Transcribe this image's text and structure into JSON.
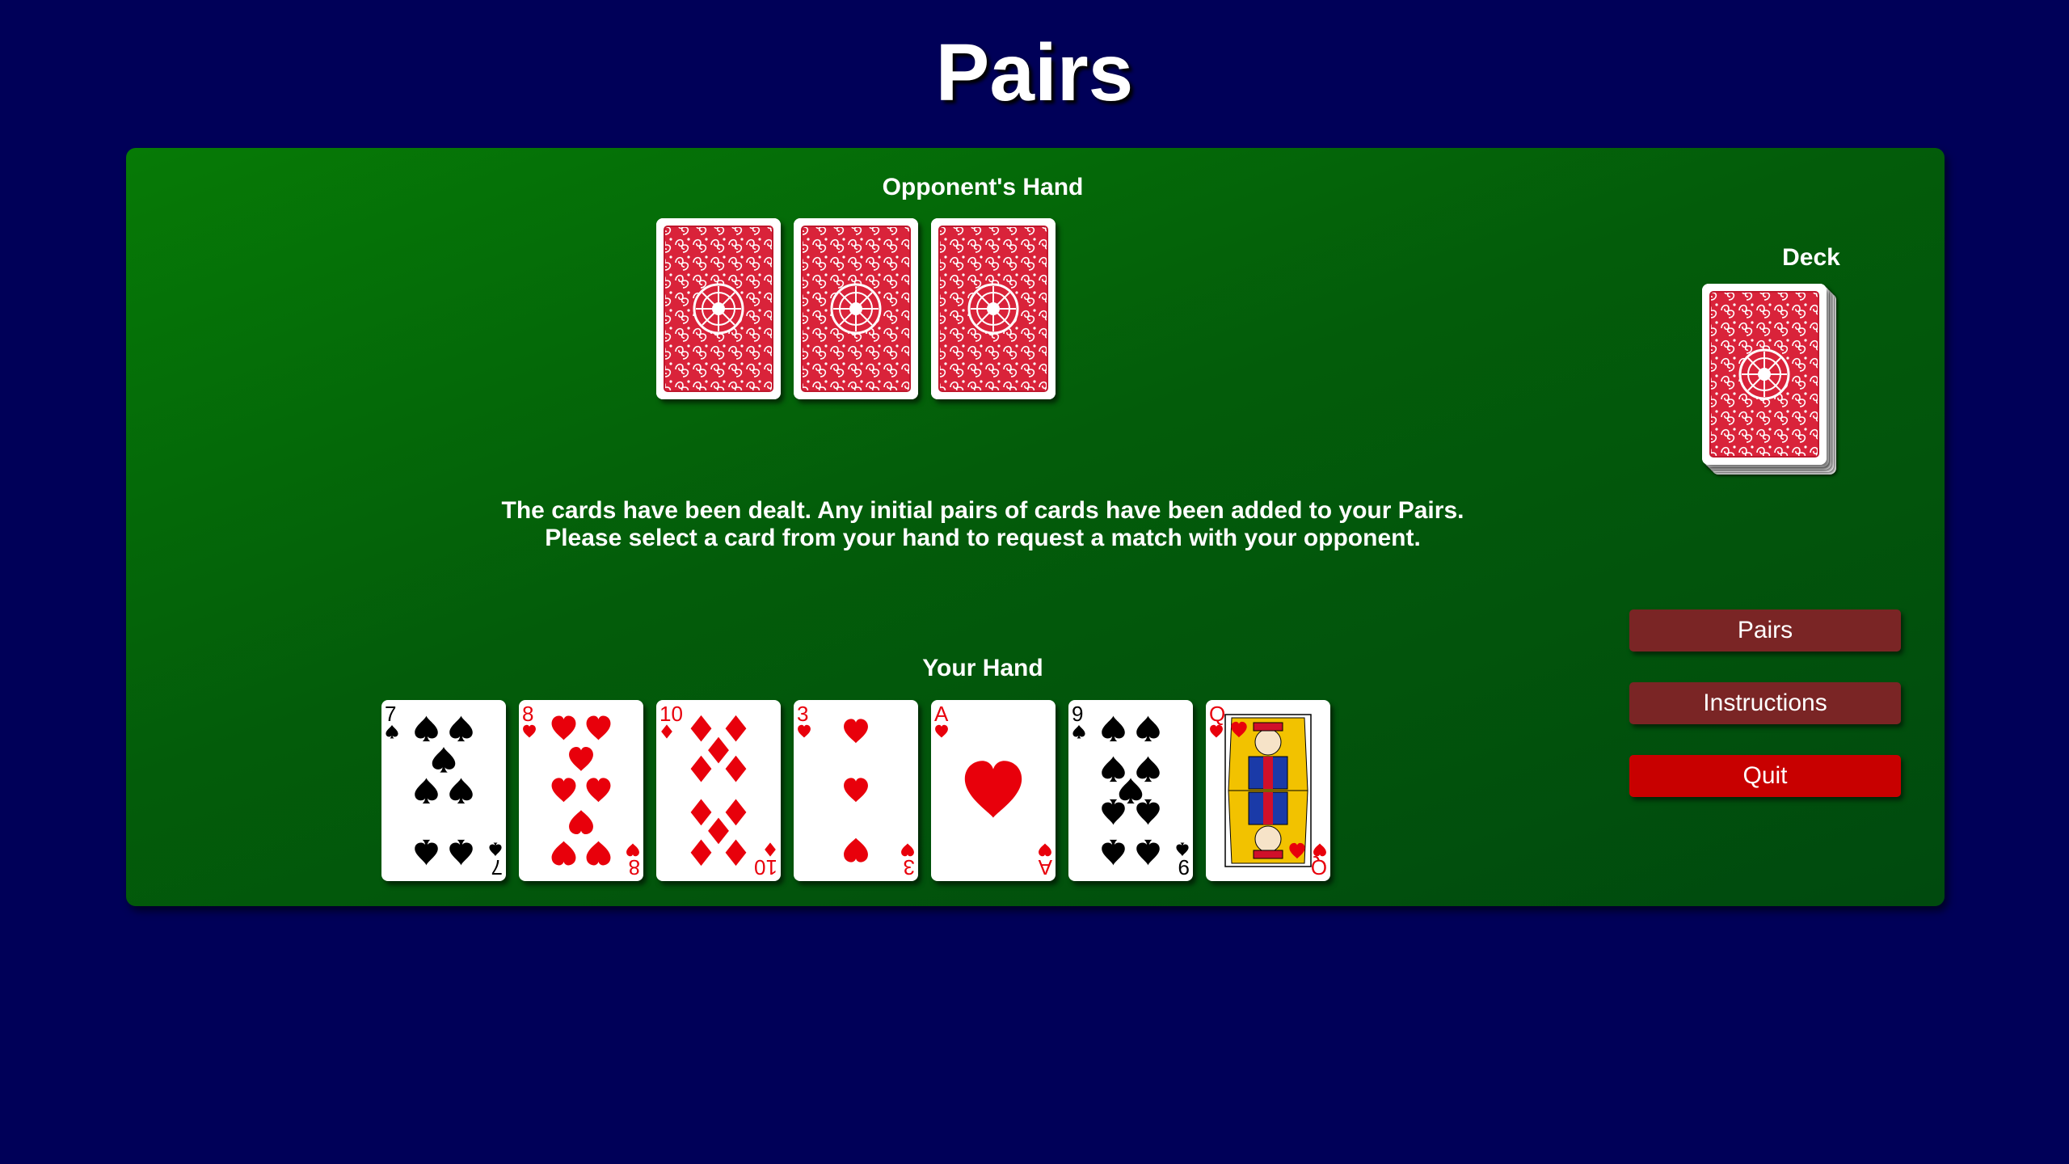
{
  "title": "Pairs",
  "opponent": {
    "label": "Opponent's Hand",
    "card_count": 3
  },
  "deck": {
    "label": "Deck"
  },
  "message": {
    "line1": "The cards have been dealt. Any initial pairs of cards have been added to your Pairs.",
    "line2": "Please select a card from your hand to request a match with your opponent."
  },
  "your_hand": {
    "label": "Your Hand",
    "cards": [
      {
        "rank": "7",
        "suit": "spades"
      },
      {
        "rank": "8",
        "suit": "hearts"
      },
      {
        "rank": "10",
        "suit": "diamonds"
      },
      {
        "rank": "3",
        "suit": "hearts"
      },
      {
        "rank": "A",
        "suit": "hearts"
      },
      {
        "rank": "9",
        "suit": "spades"
      },
      {
        "rank": "Q",
        "suit": "hearts"
      }
    ]
  },
  "buttons": {
    "pairs": "Pairs",
    "instructions": "Instructions",
    "quit": "Quit"
  },
  "colors": {
    "background": "#000058",
    "felt": "#035c0a",
    "red_suit": "#e8000b",
    "black_suit": "#000000",
    "card_back": "#d9233a",
    "button_dark": "#7a2525",
    "button_quit": "#c80000"
  }
}
